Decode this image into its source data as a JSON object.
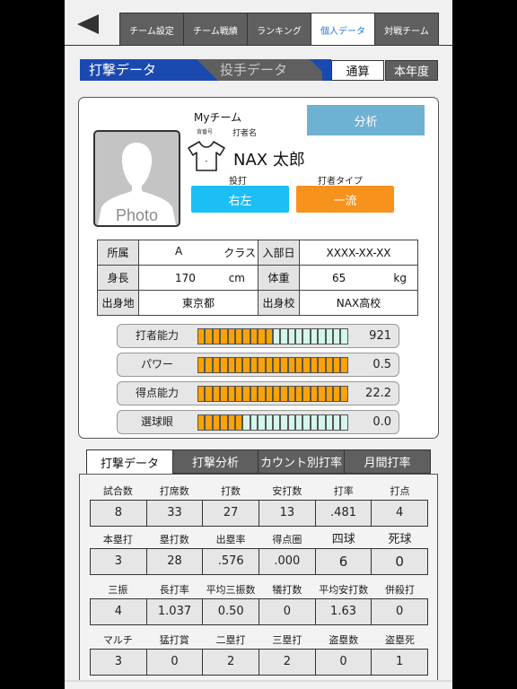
{
  "header": {
    "back_icon": "back-triangle-icon",
    "tabs": [
      {
        "label": "チーム設定",
        "active": false
      },
      {
        "label": "チーム戦績",
        "active": false
      },
      {
        "label": "ランキング",
        "active": false
      },
      {
        "label": "個人データ",
        "active": true
      },
      {
        "label": "対戦チーム",
        "active": false
      }
    ]
  },
  "segments": {
    "batting": "打撃データ",
    "pitching": "投手データ",
    "period_total": "通算",
    "period_year": "本年度"
  },
  "profile": {
    "team": "Myチーム",
    "analysis_button": "分析",
    "photo_label": "Photo",
    "number_label": "背番号",
    "name_label": "打者名",
    "uniform_number": "-",
    "name": "NAX 太郎",
    "bats_label": "投打",
    "bats_value": "右左",
    "type_label": "打者タイプ",
    "type_value": "一流",
    "info": {
      "affiliation_label": "所属",
      "affiliation_value": "A",
      "affiliation_unit": "クラス",
      "join_label": "入部日",
      "join_value": "XXXX-XX-XX",
      "height_label": "身長",
      "height_value": "170",
      "height_unit": "cm",
      "weight_label": "体重",
      "weight_value": "65",
      "weight_unit": "kg",
      "hometown_label": "出身地",
      "hometown_value": "東京都",
      "school_label": "出身校",
      "school_value": "NAX高校"
    },
    "abilities": [
      {
        "label": "打者能力",
        "filled": 10,
        "total": 20,
        "value": "921"
      },
      {
        "label": "パワー",
        "filled": 20,
        "total": 20,
        "value": "0.5"
      },
      {
        "label": "得点能力",
        "filled": 20,
        "total": 20,
        "value": "22.2"
      },
      {
        "label": "選球眼",
        "filled": 6,
        "total": 20,
        "value": "0.0"
      }
    ]
  },
  "bottom_tabs": [
    {
      "label": "打撃データ",
      "active": true
    },
    {
      "label": "打撃分析",
      "active": false
    },
    {
      "label": "カウント別打率",
      "active": false
    },
    {
      "label": "月間打率",
      "active": false
    }
  ],
  "stats": [
    {
      "heads": [
        "試合数",
        "打席数",
        "打数",
        "安打数",
        "打率",
        "打点"
      ],
      "values": [
        "8",
        "33",
        "27",
        "13",
        ".481",
        "4"
      ]
    },
    {
      "heads": [
        "本塁打",
        "塁打数",
        "出塁率",
        "得点圏",
        "四球",
        "死球"
      ],
      "values": [
        "3",
        "28",
        ".576",
        ".000",
        "6",
        "0"
      ]
    },
    {
      "heads": [
        "三振",
        "長打率",
        "平均三振数",
        "犠打数",
        "平均安打数",
        "併殺打"
      ],
      "values": [
        "4",
        "1.037",
        "0.50",
        "0",
        "1.63",
        "0"
      ]
    },
    {
      "heads": [
        "マルチ",
        "猛打賞",
        "二塁打",
        "三塁打",
        "盗塁数",
        "盗塁死"
      ],
      "values": [
        "3",
        "0",
        "2",
        "2",
        "0",
        "1"
      ]
    }
  ],
  "colors": {
    "accent_blue": "#1a4ab0",
    "active_tab_text": "#2a78d8",
    "analysis_button": "#6db1d3",
    "bats_chip": "#1bbff5",
    "type_chip": "#f7931c",
    "bar_filled": "#fea200",
    "bar_empty": "#d4f7ed"
  }
}
